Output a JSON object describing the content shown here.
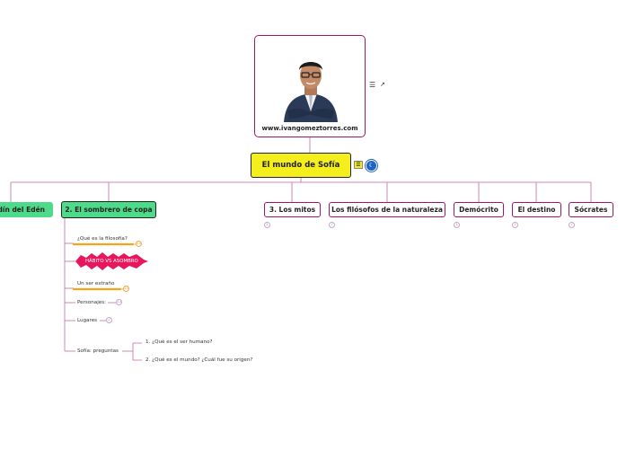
{
  "image_card": {
    "caption": "www.ivangomeztorres.com"
  },
  "central": {
    "title": "El mundo de Sofía"
  },
  "topics": [
    {
      "label": "Jardín del Edén"
    },
    {
      "label": "2. El sombrero de copa"
    },
    {
      "label": "3. Los mitos",
      "badge": "1"
    },
    {
      "label": "Los filósofos de la naturaleza",
      "badge": "7"
    },
    {
      "label": "Demócrito",
      "badge": "1"
    },
    {
      "label": "El destino",
      "badge": "1"
    },
    {
      "label": "Sócrates",
      "badge": "7"
    }
  ],
  "subtopics": [
    {
      "label": "¿Qué es la filosofía?",
      "badge": "11"
    },
    {
      "label": "HÁBITO VS ASOMBRO"
    },
    {
      "label": "Un ser extraño",
      "badge": "10"
    },
    {
      "label": "Personajes:",
      "badge": "13"
    },
    {
      "label": "Lugares",
      "badge": "2"
    },
    {
      "label": "Sofía: preguntas"
    }
  ],
  "questions": [
    {
      "label": "1. ¿Qué es el ser humano?"
    },
    {
      "label": "2. ¿Qué es el mundo? ¿Cuál fue su origen?"
    }
  ],
  "colors": {
    "branch": "#a0175d",
    "accent_green": "#4ddb8a",
    "central_fill": "#f5ee1d",
    "highlight_orange": "#f7a21b",
    "starburst": "#e8175d"
  }
}
